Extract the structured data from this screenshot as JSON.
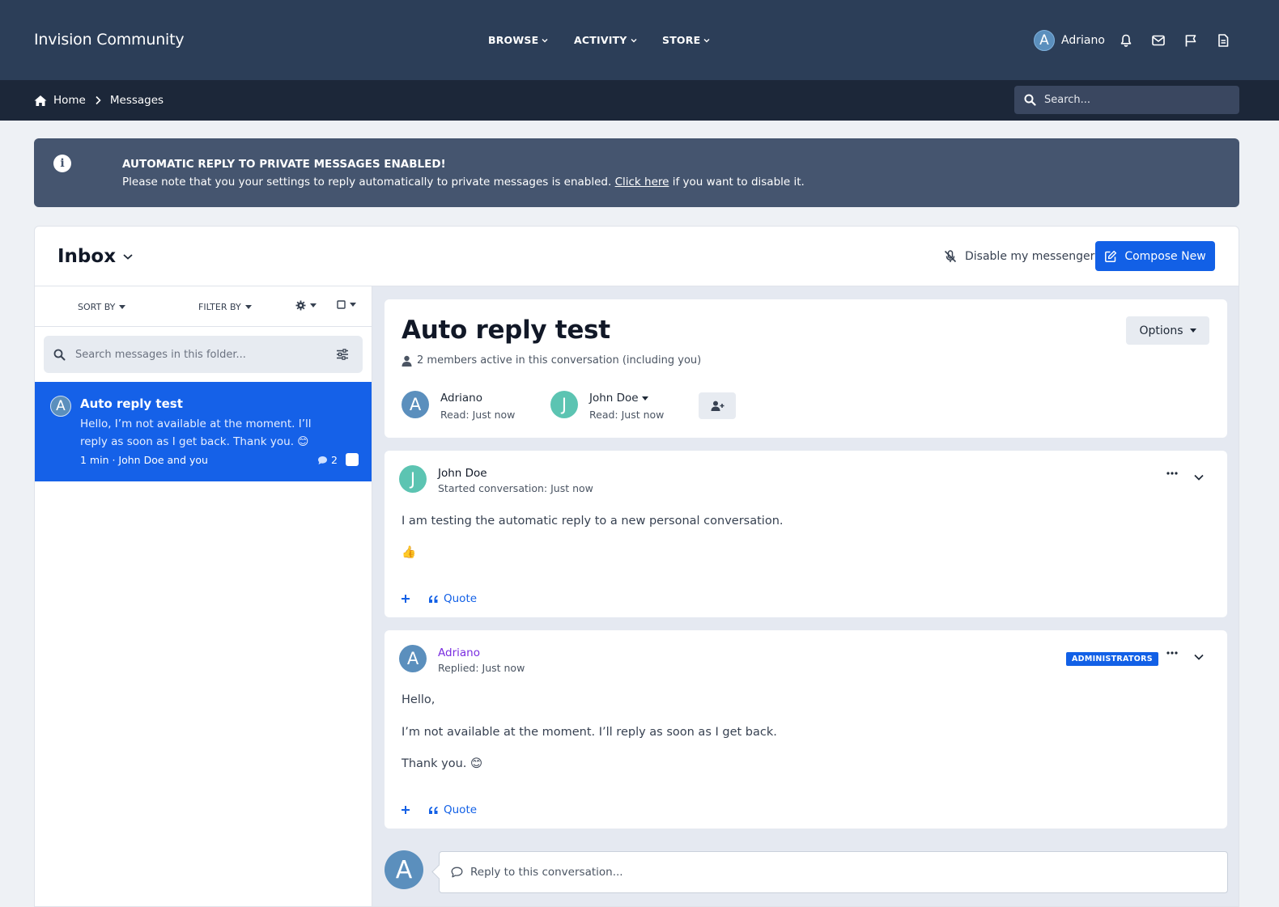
{
  "header": {
    "brand": "Invision Community",
    "nav": [
      {
        "label": "BROWSE"
      },
      {
        "label": "ACTIVITY"
      },
      {
        "label": "STORE"
      }
    ],
    "user": {
      "name": "Adriano",
      "initial": "A"
    },
    "icons": [
      "bell-icon",
      "envelope-icon",
      "flag-icon",
      "document-icon"
    ]
  },
  "breadcrumb": {
    "home": "Home",
    "current": "Messages"
  },
  "search": {
    "placeholder": "Search..."
  },
  "banner": {
    "title": "AUTOMATIC REPLY TO PRIVATE MESSAGES ENABLED!",
    "text_before": "Please note that you your settings to reply automatically to private messages is enabled.",
    "link": "Click here",
    "text_after": "if you want to disable it."
  },
  "inbox": {
    "title": "Inbox",
    "disable_label": "Disable my messenger",
    "compose_label": "Compose New"
  },
  "list": {
    "sort_label": "SORT BY",
    "filter_label": "FILTER BY",
    "search_placeholder": "Search messages in this folder...",
    "items": [
      {
        "initial": "A",
        "title": "Auto reply test",
        "snippet": "Hello, I’m not available at the moment. I’ll reply as soon as I get back. Thank you. 😊",
        "meta": "1 min · John Doe and you",
        "count": "2"
      }
    ]
  },
  "conversation": {
    "title": "Auto reply test",
    "subtitle": "2 members active in this conversation (including you)",
    "options_label": "Options",
    "members": [
      {
        "initial": "A",
        "name": "Adriano",
        "read": "Read: Just now",
        "color": "#5b8fbd"
      },
      {
        "initial": "J",
        "name": "John Doe",
        "read": "Read: Just now",
        "color": "#5cc4b2"
      }
    ],
    "posts": [
      {
        "initial": "J",
        "author": "John Doe",
        "when": "Started conversation: Just now",
        "color": "#5cc4b2",
        "lines": [
          "I am testing the automatic reply to a new personal conversation.",
          "👍"
        ],
        "quote_label": "Quote"
      },
      {
        "initial": "A",
        "author": "Adriano",
        "when": "Replied: Just now",
        "color": "#5b8fbd",
        "badge": "ADMINISTRATORS",
        "author_color": "#7a2de0",
        "lines": [
          "Hello,",
          "I’m not available at the moment. I’ll reply as soon as I get back.",
          "Thank you. 😊"
        ],
        "quote_label": "Quote"
      }
    ],
    "reply": {
      "initial": "A",
      "placeholder": "Reply to this conversation..."
    }
  },
  "colors": {
    "header_bg": "#2c3e58",
    "subbar_bg": "#1c2739",
    "banner_bg": "#45556f",
    "accent": "#1260e6",
    "admin_name": "#7a2de0",
    "member_teal": "#5cc4b2",
    "member_blue": "#5b8fbd"
  }
}
